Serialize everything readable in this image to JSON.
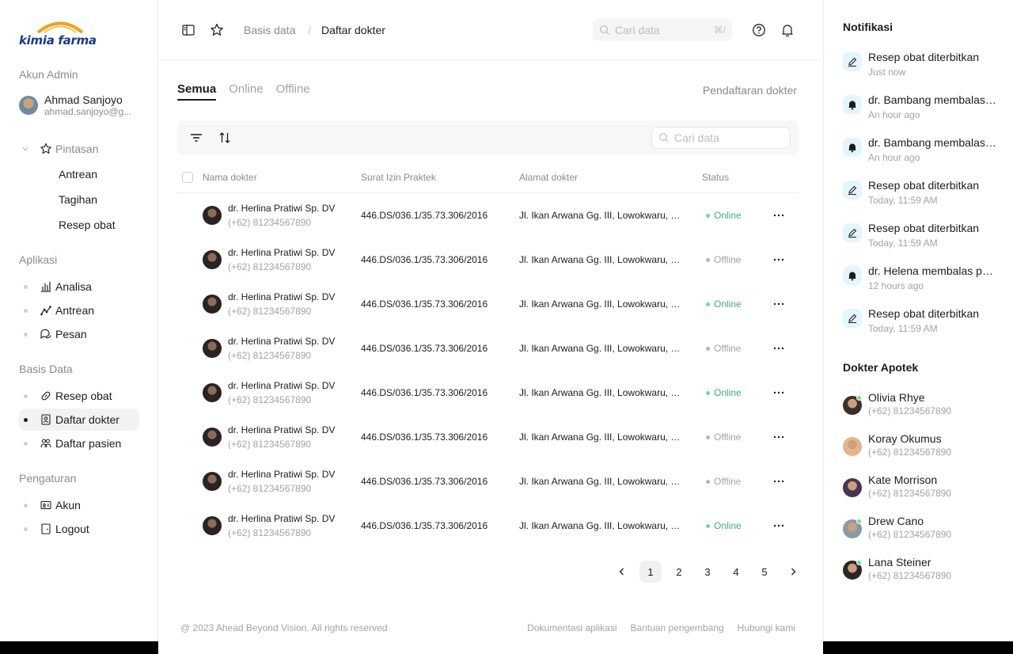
{
  "brand": {
    "logo_text": "kimia farma",
    "accent": "#1b3a8c",
    "arc_color": "#f2a21b"
  },
  "sidebar": {
    "admin_section": "Akun Admin",
    "admin_name": "Ahmad Sanjoyo",
    "admin_email": "ahmad.sanjoyo@g...",
    "shortcuts": {
      "label": "Pintasan",
      "icon": "star-icon",
      "items": [
        "Antrean",
        "Tagihan",
        "Resep obat"
      ]
    },
    "apps_section": "Aplikasi",
    "apps": [
      {
        "label": "Analisa",
        "icon": "chart-bar-icon"
      },
      {
        "label": "Antrean",
        "icon": "line-chart-icon"
      },
      {
        "label": "Pesan",
        "icon": "chat-icon"
      }
    ],
    "db_section": "Basis Data",
    "db": [
      {
        "label": "Resep obat",
        "icon": "link-icon"
      },
      {
        "label": "Daftar dokter",
        "icon": "id-badge-icon",
        "active": true
      },
      {
        "label": "Daftar pasien",
        "icon": "users-icon"
      }
    ],
    "settings_section": "Pengaturan",
    "settings": [
      {
        "label": "Akun",
        "icon": "id-card-icon"
      },
      {
        "label": "Logout",
        "icon": "logout-icon"
      }
    ]
  },
  "topbar": {
    "breadcrumb_parent": "Basis data",
    "breadcrumb_sep": "/",
    "breadcrumb_current": "Daftar dokter",
    "search_placeholder": "Cari data",
    "search_shortcut": "⌘/"
  },
  "tabs": [
    {
      "label": "Semua",
      "active": true
    },
    {
      "label": "Online",
      "active": false
    },
    {
      "label": "Offline",
      "active": false
    }
  ],
  "register_link": "Pendaftaran dokter",
  "table": {
    "search_placeholder": "Cari data",
    "columns": [
      "Nama dokter",
      "Surat Izin Praktek",
      "Alamat dokter",
      "Status"
    ],
    "rows": [
      {
        "name": "dr. Herlina Pratiwi Sp. DV",
        "phone": "(+62) 81234567890",
        "sip": "446.DS/036.1/35.73.306/2016",
        "address": "Jl. Ikan Arwana Gg. III, Lowokwaru, Malang",
        "status": "Online"
      },
      {
        "name": "dr. Herlina Pratiwi Sp. DV",
        "phone": "(+62) 81234567890",
        "sip": "446.DS/036.1/35.73.306/2016",
        "address": "Jl. Ikan Arwana Gg. III, Lowokwaru, Malang",
        "status": "Offline"
      },
      {
        "name": "dr. Herlina Pratiwi Sp. DV",
        "phone": "(+62) 81234567890",
        "sip": "446.DS/036.1/35.73.306/2016",
        "address": "Jl. Ikan Arwana Gg. III, Lowokwaru, Malang",
        "status": "Online"
      },
      {
        "name": "dr. Herlina Pratiwi Sp. DV",
        "phone": "(+62) 81234567890",
        "sip": "446.DS/036.1/35.73.306/2016",
        "address": "Jl. Ikan Arwana Gg. III, Lowokwaru, Malang",
        "status": "Offline"
      },
      {
        "name": "dr. Herlina Pratiwi Sp. DV",
        "phone": "(+62) 81234567890",
        "sip": "446.DS/036.1/35.73.306/2016",
        "address": "Jl. Ikan Arwana Gg. III, Lowokwaru, Malang",
        "status": "Online"
      },
      {
        "name": "dr. Herlina Pratiwi Sp. DV",
        "phone": "(+62) 81234567890",
        "sip": "446.DS/036.1/35.73.306/2016",
        "address": "Jl. Ikan Arwana Gg. III, Lowokwaru, Malang",
        "status": "Offline"
      },
      {
        "name": "dr. Herlina Pratiwi Sp. DV",
        "phone": "(+62) 81234567890",
        "sip": "446.DS/036.1/35.73.306/2016",
        "address": "Jl. Ikan Arwana Gg. III, Lowokwaru, Malang",
        "status": "Offline"
      },
      {
        "name": "dr. Herlina Pratiwi Sp. DV",
        "phone": "(+62) 81234567890",
        "sip": "446.DS/036.1/35.73.306/2016",
        "address": "Jl. Ikan Arwana Gg. III, Lowokwaru, Malang",
        "status": "Online"
      }
    ]
  },
  "pagination": {
    "pages": [
      "1",
      "2",
      "3",
      "4",
      "5"
    ],
    "current": "1"
  },
  "footer": {
    "copyright": "@ 2023 Ahead Beyond Vision. All rights reserved",
    "links": [
      "Dokumentasi aplikasi",
      "Bantuan pengembang",
      "Hubungi kami"
    ]
  },
  "notifications": {
    "title": "Notifikasi",
    "items": [
      {
        "text": "Resep obat diterbitkan",
        "time": "Just now",
        "icon": "edit-icon"
      },
      {
        "text": "dr. Bambang membalas pesan",
        "time": "An hour ago",
        "icon": "bell-icon"
      },
      {
        "text": "dr. Bambang membalas pesan",
        "time": "An hour ago",
        "icon": "bell-icon"
      },
      {
        "text": "Resep obat diterbitkan",
        "time": "Today, 11:59 AM",
        "icon": "edit-icon"
      },
      {
        "text": "Resep obat diterbitkan",
        "time": "Today, 11:59 AM",
        "icon": "edit-icon"
      },
      {
        "text": "dr. Helena membalas pesan",
        "time": "12 hours ago",
        "icon": "bell-icon"
      },
      {
        "text": "Resep obat diterbitkan",
        "time": "Today, 11:59 AM",
        "icon": "edit-icon"
      }
    ]
  },
  "pharmacists": {
    "title": "Dokter Apotek",
    "items": [
      {
        "name": "Olivia Rhye",
        "phone": "(+62) 81234567890",
        "online": true,
        "avatar_color": "#3b2f2a"
      },
      {
        "name": "Koray Okumus",
        "phone": "(+62) 81234567890",
        "online": false,
        "avatar_color": "#e7b48a"
      },
      {
        "name": "Kate Morrison",
        "phone": "(+62) 81234567890",
        "online": false,
        "avatar_color": "#4a3550"
      },
      {
        "name": "Drew Cano",
        "phone": "(+62) 81234567890",
        "online": true,
        "avatar_color": "#8a9aa5"
      },
      {
        "name": "Lana Steiner",
        "phone": "(+62) 81234567890",
        "online": true,
        "avatar_color": "#2b2624"
      }
    ]
  }
}
